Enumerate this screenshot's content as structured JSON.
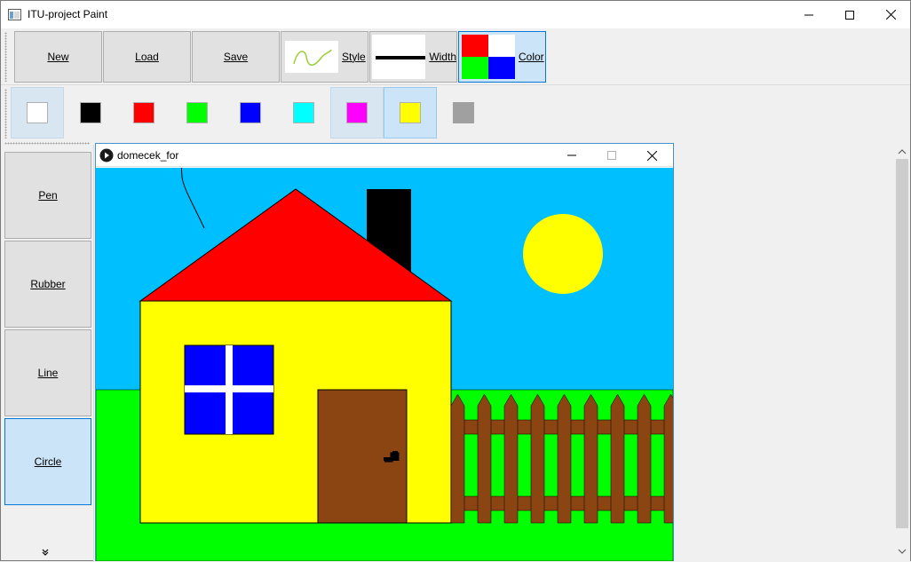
{
  "window": {
    "title": "ITU-project Paint"
  },
  "toolbar": {
    "new_label": "New",
    "load_label": "Load",
    "save_label": "Save",
    "style_label": "Style",
    "width_label": "Width",
    "color_label": "Color"
  },
  "palette": {
    "colors": [
      "#ffffff",
      "#000000",
      "#ff0000",
      "#00ff00",
      "#0000ff",
      "#00ffff",
      "#ff00ff",
      "#ffff00",
      "#a0a0a0"
    ],
    "selected_color": "#ffff00"
  },
  "tools": {
    "pen_label": "Pen",
    "rubber_label": "Rubber",
    "line_label": "Line",
    "circle_label": "Circle",
    "active": "Circle"
  },
  "document": {
    "title": "domecek_for"
  },
  "colors": {
    "sky": "#00bfff",
    "grass": "#00ff00",
    "roof": "#ff0000",
    "wall": "#ffff00",
    "window": "#0000ff",
    "door": "#8b4513",
    "fence": "#8b4513",
    "sun": "#ffff00",
    "chimney": "#000000"
  }
}
